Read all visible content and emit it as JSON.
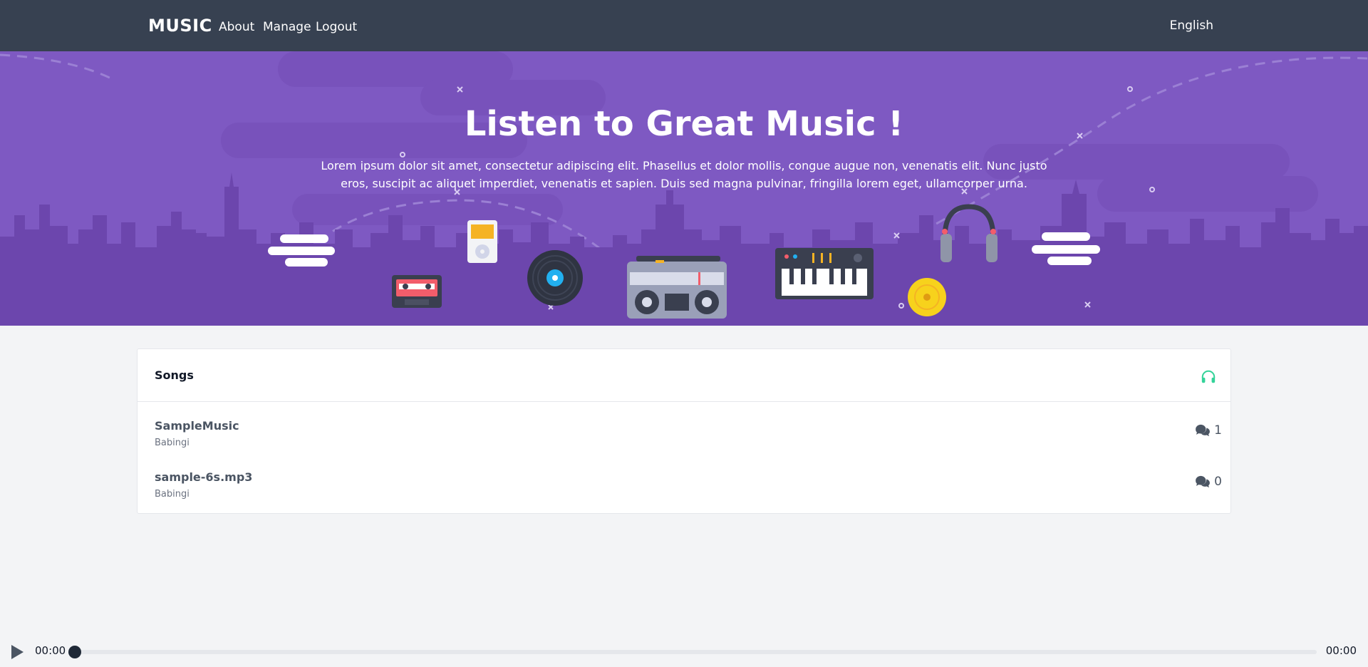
{
  "nav": {
    "brand": "MUSIC",
    "links": [
      "About",
      "Manage",
      "Logout"
    ],
    "language": "English"
  },
  "hero": {
    "title": "Listen to Great Music !",
    "text": "Lorem ipsum dolor sit amet, consectetur adipiscing elit. Phasellus et dolor mollis, congue augue non, venenatis elit. Nunc justo eros, suscipit ac aliquet imperdiet, venenatis et sapien. Duis sed magna pulvinar, fringilla lorem eget, ullamcorper urna.",
    "illustrations": [
      "cloud",
      "cassette-tape",
      "ipod",
      "vinyl-record",
      "boombox",
      "synth-keyboard",
      "cd-disc",
      "headphones",
      "cloud"
    ]
  },
  "songs": {
    "title": "Songs",
    "header_icon": "headphones-icon",
    "items": [
      {
        "title": "SampleMusic",
        "artist": "Babingi",
        "comments": "1"
      },
      {
        "title": "sample-6s.mp3",
        "artist": "Babingi",
        "comments": "0"
      }
    ]
  },
  "player": {
    "current_time": "00:00",
    "duration": "00:00",
    "progress": 0
  },
  "colors": {
    "navbar": "#374151",
    "hero": "#7e59c2",
    "accent_green": "#34d399",
    "knob": "#1f2937"
  }
}
